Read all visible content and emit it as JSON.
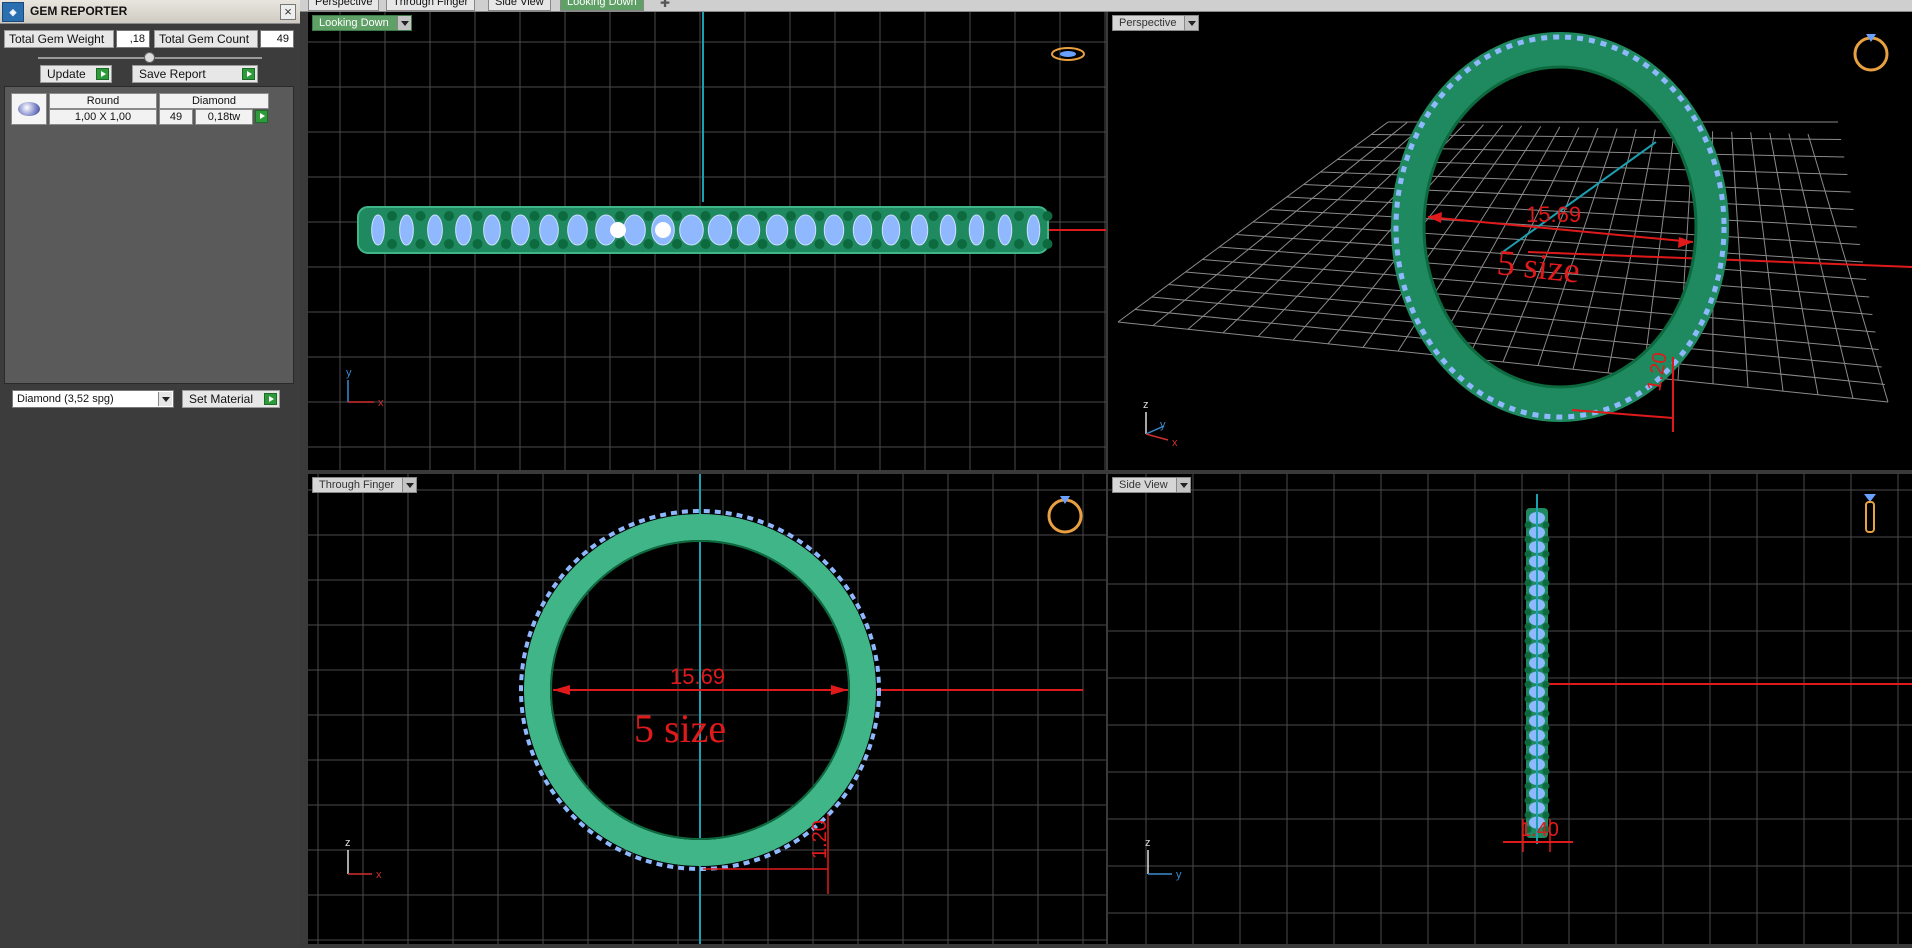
{
  "panel": {
    "title": "GEM REPORTER",
    "logo_icon": "gem-reporter-app-icon",
    "close_label": "×",
    "total_weight_label": "Total Gem Weight",
    "total_weight_value": ",18",
    "total_count_label": "Total Gem Count",
    "total_count_value": "49",
    "update_label": "Update",
    "save_report_label": "Save Report",
    "gems": [
      {
        "shape": "Round",
        "type": "Diamond",
        "size": "1,00 X 1,00",
        "count": "49",
        "weight": "0,18tw"
      }
    ],
    "material_value": "Diamond    (3,52 spg)",
    "set_material_label": "Set Material"
  },
  "tabs": [
    {
      "label": "Perspective",
      "active": false
    },
    {
      "label": "Through Finger",
      "active": false
    },
    {
      "label": "Side View",
      "active": false
    },
    {
      "label": "Looking Down",
      "active": true
    }
  ],
  "viewports": {
    "looking_down": {
      "label": "Looking Down",
      "axis_y": "y",
      "axis_x": "x"
    },
    "perspective": {
      "label": "Perspective",
      "dimension": "15.69",
      "size_text": "5 size",
      "height_dim": "1.20",
      "axis_z": "z",
      "axis_y": "y",
      "axis_x": "x"
    },
    "through_finger": {
      "label": "Through Finger",
      "dimension": "15.69",
      "size_text": "5 size",
      "height_dim": "1.20",
      "axis_z": "z",
      "axis_x": "x"
    },
    "side_view": {
      "label": "Side View",
      "width_dim": "1.40",
      "axis_z": "z",
      "axis_y": "y"
    }
  },
  "colors": {
    "band": "#1f8a5f",
    "band_light": "#3fb588",
    "gem": "#8fb8ff",
    "prong": "#0d6a3f",
    "dimension": "#e01a1a",
    "grid": "#5a5a5a",
    "axis_line": "#1aa0b0",
    "ring_icon": "#e8a040"
  }
}
